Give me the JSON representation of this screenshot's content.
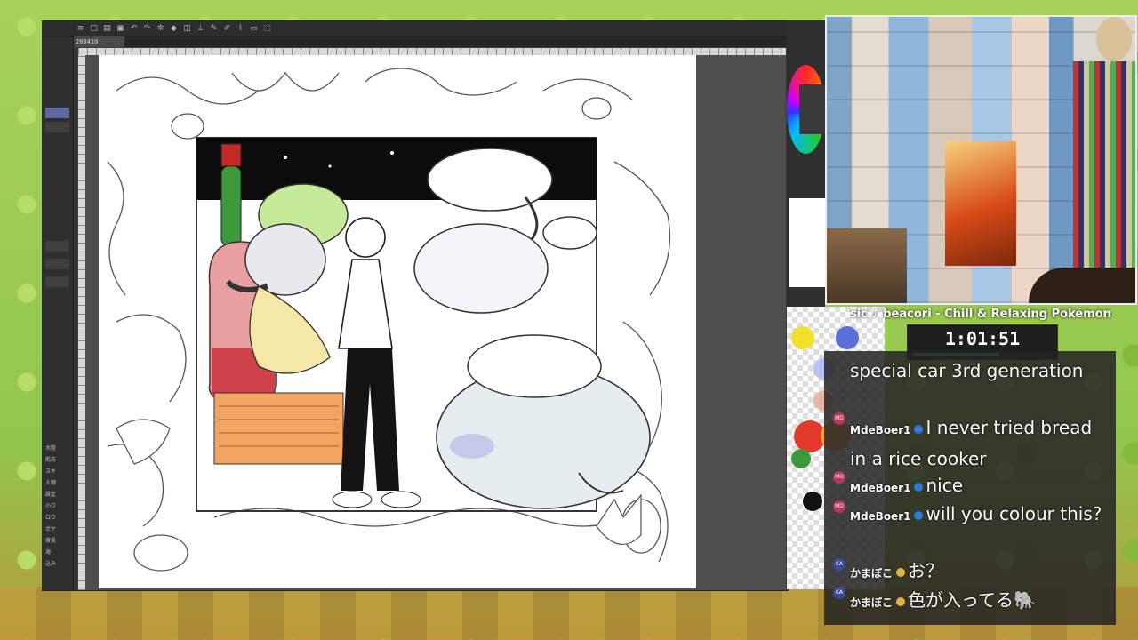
{
  "app": {
    "document_tab": "260410",
    "left_panel_labels": [
      "大陸",
      "前方",
      "スキ",
      "人物",
      "設定",
      "小ワ",
      "ロワ",
      "ポヤ",
      "背景",
      "海",
      "込み"
    ],
    "toolbar_icons": [
      "menu-icon",
      "new-icon",
      "open-icon",
      "save-icon",
      "undo-icon",
      "redo-icon",
      "settings-icon",
      "fill-icon",
      "transform-icon",
      "ruler-icon",
      "pen-icon",
      "pencil-icon",
      "brush-icon",
      "eraser-icon",
      "select-icon"
    ]
  },
  "overlay": {
    "music_ticker": "sic ♪ beacori - Chill & Relaxing Pokémon",
    "timer": "1:01:51",
    "timer_progress": 0.62
  },
  "chat": {
    "messages": [
      {
        "user": "",
        "text": "special car 3rd generation"
      },
      {
        "user": "MdeBoer1",
        "text": "I never tried bread in a rice cooker"
      },
      {
        "user": "MdeBoer1",
        "text": "nice"
      },
      {
        "user": "MdeBoer1",
        "text": "will you colour this?"
      },
      {
        "user": "かまぼこ",
        "text": "お？"
      },
      {
        "user": "かまぼこ",
        "text": "色が入ってる🐘"
      }
    ]
  },
  "palette_colors": [
    "#f2e12a",
    "#5a70d8",
    "#b7c2f2",
    "#e8b6a5",
    "#e23a2a",
    "#f2a23a",
    "#111111",
    "#3a9a3a"
  ]
}
